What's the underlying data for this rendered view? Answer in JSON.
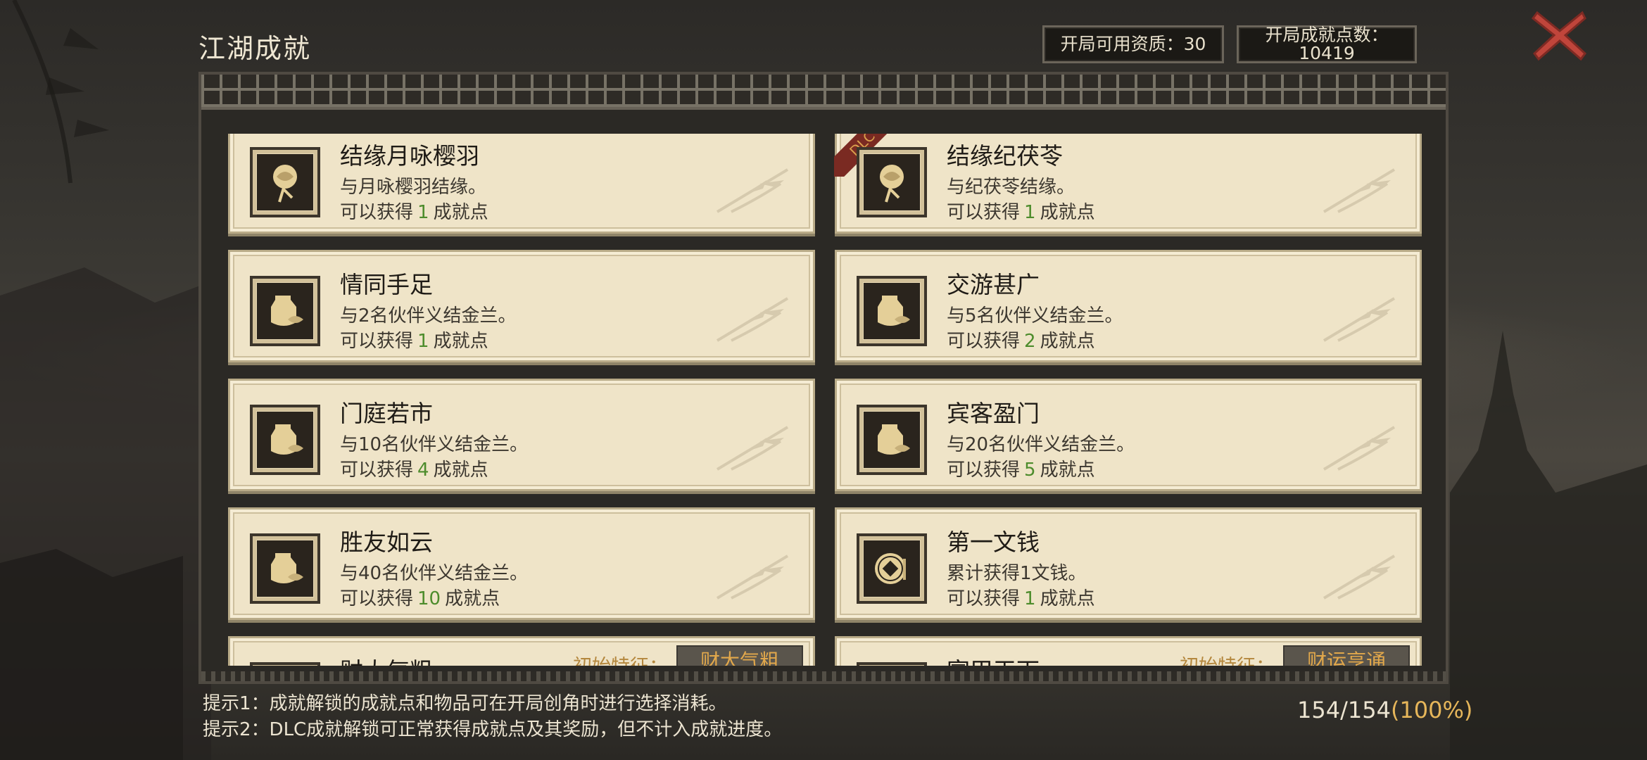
{
  "header": {
    "title": "江湖成就",
    "aptitude_label": "开局可用资质：30",
    "points_label": "开局成就点数：",
    "points_value": "10419",
    "close_icon": "close-x-icon"
  },
  "achievements": [
    {
      "name": "结缘月咏樱羽",
      "desc": "与月咏樱羽结缘。",
      "reward_prefix": "可以获得",
      "points": "1",
      "reward_suffix": "成就点",
      "icon": "rose-icon",
      "dlc": false
    },
    {
      "name": "结缘纪茯苓",
      "desc": "与纪茯苓结缘。",
      "reward_prefix": "可以获得",
      "points": "1",
      "reward_suffix": "成就点",
      "icon": "rose-icon",
      "dlc": true,
      "dlc_label": "DLC"
    },
    {
      "name": "情同手足",
      "desc": "与2名伙伴义结金兰。",
      "reward_prefix": "可以获得",
      "points": "1",
      "reward_suffix": "成就点",
      "icon": "wine-jar-icon",
      "dlc": false
    },
    {
      "name": "交游甚广",
      "desc": "与5名伙伴义结金兰。",
      "reward_prefix": "可以获得",
      "points": "2",
      "reward_suffix": "成就点",
      "icon": "wine-jar-icon",
      "dlc": false
    },
    {
      "name": "门庭若市",
      "desc": "与10名伙伴义结金兰。",
      "reward_prefix": "可以获得",
      "points": "4",
      "reward_suffix": "成就点",
      "icon": "wine-jar-icon",
      "dlc": false
    },
    {
      "name": "宾客盈门",
      "desc": "与20名伙伴义结金兰。",
      "reward_prefix": "可以获得",
      "points": "5",
      "reward_suffix": "成就点",
      "icon": "wine-jar-icon",
      "dlc": false
    },
    {
      "name": "胜友如云",
      "desc": "与40名伙伴义结金兰。",
      "reward_prefix": "可以获得",
      "points": "10",
      "reward_suffix": "成就点",
      "icon": "wine-jar-icon",
      "dlc": false
    },
    {
      "name": "第一文钱",
      "desc": "累计获得1文钱。",
      "reward_prefix": "可以获得",
      "points": "1",
      "reward_suffix": "成就点",
      "icon": "coin-icon",
      "dlc": false
    },
    {
      "name": "财大气粗",
      "trait_label": "初始特征：",
      "trait_value": "财大气粗",
      "icon": "money-pouch-icon"
    },
    {
      "name": "富甲天下",
      "trait_label": "初始特征：",
      "trait_value": "财运亨通",
      "icon": "money-pouch-icon"
    }
  ],
  "tips": {
    "tip1": "提示1：成就解锁的成就点和物品可在开局创角时进行选择消耗。",
    "tip2": "提示2：DLC成就解锁可正常获得成就点及其奖励，但不计入成就进度。"
  },
  "progress": {
    "count": "154/154",
    "percent": "(100%)",
    "fraction": 1.0
  },
  "colors": {
    "card_bg": "#efe4c8",
    "reward_green": "#4d8c2c",
    "trait_gold": "#e2a84b",
    "close_red": "#c0453b"
  }
}
